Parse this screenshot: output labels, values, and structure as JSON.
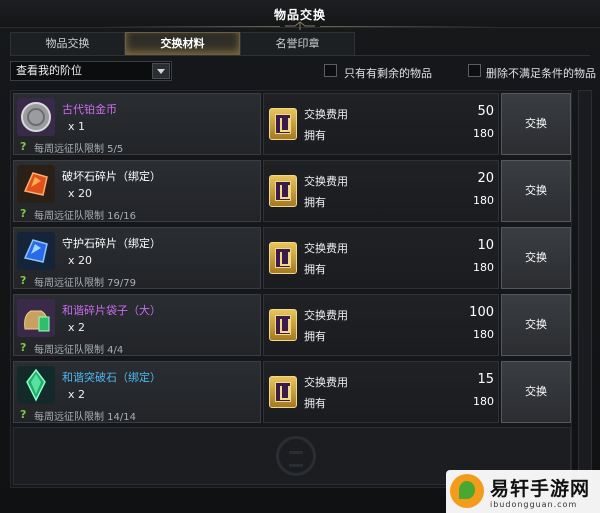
{
  "window": {
    "title": "物品交换"
  },
  "tabs": [
    {
      "label": "物品交换",
      "active": false
    },
    {
      "label": "交换材料",
      "active": true
    },
    {
      "label": "名誉印章",
      "active": false
    }
  ],
  "filters": {
    "tier_select": "查看我的阶位",
    "only_remaining_label": "只有有剩余的物品",
    "hide_unmet_label": "删除不满足条件的物品"
  },
  "cost_labels": {
    "cost": "交换费用",
    "owned": "拥有"
  },
  "items": [
    {
      "name": "古代铂金币",
      "name_color": "#c86cf0",
      "qty": "x 1",
      "limit": "每周远征队限制 5/5",
      "cost": "50",
      "owned": "180",
      "button": "交换",
      "icon": "ancient-platinum-coin-icon"
    },
    {
      "name": "破坏石碎片（绑定）",
      "name_color": "#ffffff",
      "qty": "x 20",
      "limit": "每周远征队限制 16/16",
      "cost": "20",
      "owned": "180",
      "button": "交换",
      "icon": "destruction-stone-fragment-icon"
    },
    {
      "name": "守护石碎片（绑定）",
      "name_color": "#ffffff",
      "qty": "x 20",
      "limit": "每周远征队限制 79/79",
      "cost": "10",
      "owned": "180",
      "button": "交换",
      "icon": "guardian-stone-fragment-icon"
    },
    {
      "name": "和谐碎片袋子（大）",
      "name_color": "#c86cf0",
      "qty": "x 2",
      "limit": "每周远征队限制 4/4",
      "cost": "100",
      "owned": "180",
      "button": "交换",
      "icon": "harmony-shard-pouch-icon"
    },
    {
      "name": "和谐突破石（绑定）",
      "name_color": "#4fb9f2",
      "qty": "x 2",
      "limit": "每周远征队限制 14/14",
      "cost": "15",
      "owned": "180",
      "button": "交换",
      "icon": "harmony-leapstone-icon"
    }
  ],
  "watermark": {
    "text": "易轩手游网",
    "sub": "ibudongguan.com"
  }
}
